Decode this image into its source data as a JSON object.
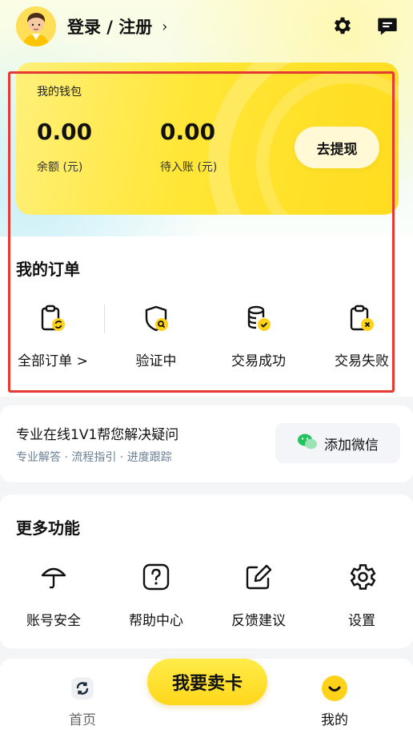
{
  "header": {
    "login_label": "登录 / 注册",
    "chevron": "›",
    "icons": [
      "gear-icon",
      "message-icon"
    ]
  },
  "wallet": {
    "title": "我的钱包",
    "balance_value": "0.00",
    "balance_label": "余额 (元)",
    "pending_value": "0.00",
    "pending_label": "待入账 (元)",
    "withdraw_label": "去提现",
    "color": "#ffe636"
  },
  "orders": {
    "title": "我的订单",
    "items": [
      {
        "label": "全部订单 >",
        "icon": "clipboard-refresh-icon"
      },
      {
        "label": "验证中",
        "icon": "shield-search-icon"
      },
      {
        "label": "交易成功",
        "icon": "coins-check-icon"
      },
      {
        "label": "交易失败",
        "icon": "clipboard-x-icon"
      }
    ]
  },
  "help": {
    "title": "专业在线1V1帮您解决疑问",
    "subtitle": "专业解答 · 流程指引 · 进度跟踪",
    "wechat_label": "添加微信"
  },
  "more": {
    "title": "更多功能",
    "items": [
      {
        "label": "账号安全",
        "icon": "umbrella-icon"
      },
      {
        "label": "帮助中心",
        "icon": "question-icon"
      },
      {
        "label": "反馈建议",
        "icon": "edit-icon"
      },
      {
        "label": "设置",
        "icon": "gear-icon"
      }
    ]
  },
  "tabbar": {
    "home_label": "首页",
    "sell_label": "我要卖卡",
    "mine_label": "我的"
  },
  "colors": {
    "accent_yellow": "#ffd71a",
    "highlight_red": "#e53935",
    "wechat_green": "#22c35e"
  }
}
